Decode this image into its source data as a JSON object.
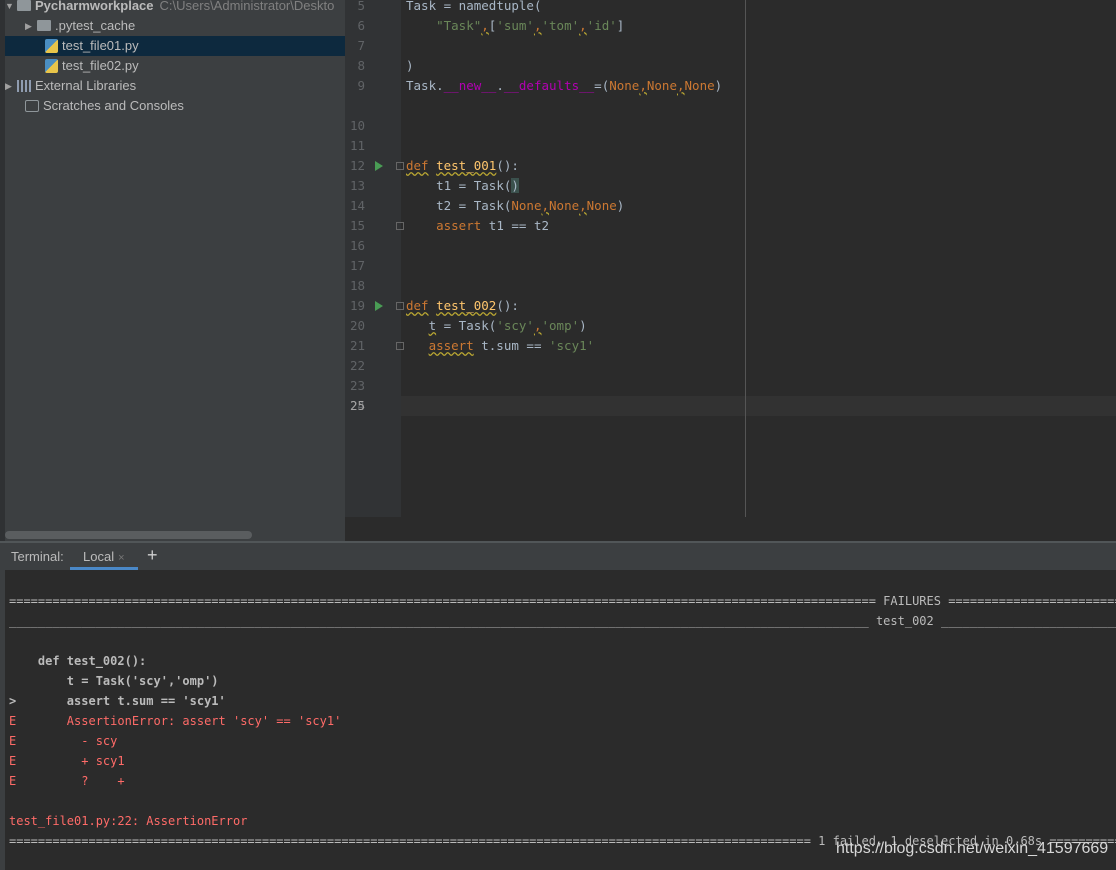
{
  "project_tree": {
    "root_name": "Pycharmworkplace",
    "root_path": "C:\\Users\\Administrator\\Deskto",
    "items": [
      {
        "label": ".pytest_cache"
      },
      {
        "label": "test_file01.py"
      },
      {
        "label": "test_file02.py"
      },
      {
        "label": "External Libraries"
      },
      {
        "label": "Scratches and Consoles"
      }
    ]
  },
  "editor": {
    "line_numbers": [
      "5",
      "6",
      "7",
      "8",
      "9",
      "10",
      "11",
      "12",
      "13",
      "14",
      "15",
      "16",
      "17",
      "18",
      "19",
      "20",
      "21",
      "22",
      "23",
      "24",
      "25"
    ],
    "code": {
      "l5_a": "Task",
      "l5_b": " = namedtuple(",
      "l6_s1": "\"Task\"",
      "l6_c1": ",",
      "l6_b": "[",
      "l6_s2": "'sum'",
      "l6_c2": ",",
      "l6_s3": "'tom'",
      "l6_c3": ",",
      "l6_s4": "'id'",
      "l6_e": "]",
      "l8": ")",
      "l9_a": "Task.",
      "l9_b": "__new__",
      "l9_c": ".",
      "l9_d": "__defaults__",
      "l9_e": "=(",
      "l9_n1": "None",
      "l9_c1": ",",
      "l9_n2": "None",
      "l9_c2": ",",
      "l9_n3": "None",
      "l9_f": ")",
      "l13_kw": "def",
      "l13_fn": "test_001",
      "l13_e": "():",
      "l14_a": "t1 = Task(",
      "l14_b": ")",
      "l15_a": "t2 = Task(",
      "l15_n1": "None",
      "l15_c1": ",",
      "l15_n2": "None",
      "l15_c2": ",",
      "l15_n3": "None",
      "l15_e": ")",
      "l16_kw": "assert",
      "l16_e": " t1 == t2",
      "l20_kw": "def",
      "l20_fn": "test_002",
      "l20_e": "():",
      "l21_a": "t",
      "l21_b": " = Task(",
      "l21_s1": "'scy'",
      "l21_c1": ",",
      "l21_s2": "'omp'",
      "l21_e": ")",
      "l22_kw": "assert",
      "l22_b": " t.sum == ",
      "l22_s": "'scy1'"
    }
  },
  "terminal": {
    "label": "Terminal:",
    "tab_label": "Local",
    "close_glyph": "×",
    "add_glyph": "+",
    "failures_line": "======================================================================================================================== FAILURES =====================================================================================================================",
    "test_header_line": "_______________________________________________________________________________________________________________________ test_002 ______________________________________________________________________________________________________________________",
    "lines": [
      "    def test_002():",
      "        t = Task('scy','omp')",
      ">       assert t.sum == 'scy1'",
      "E       AssertionError: assert 'scy' == 'scy1'",
      "E         - scy",
      "E         + scy1",
      "E         ?    +"
    ],
    "error_location": "test_file01.py:22: AssertionError",
    "summary_line": "=============================================================================================================== 1 failed, 1 deselected in 0.68s ================================================================================================================"
  },
  "watermark": "https://blog.csdn.net/weixin_41597669"
}
